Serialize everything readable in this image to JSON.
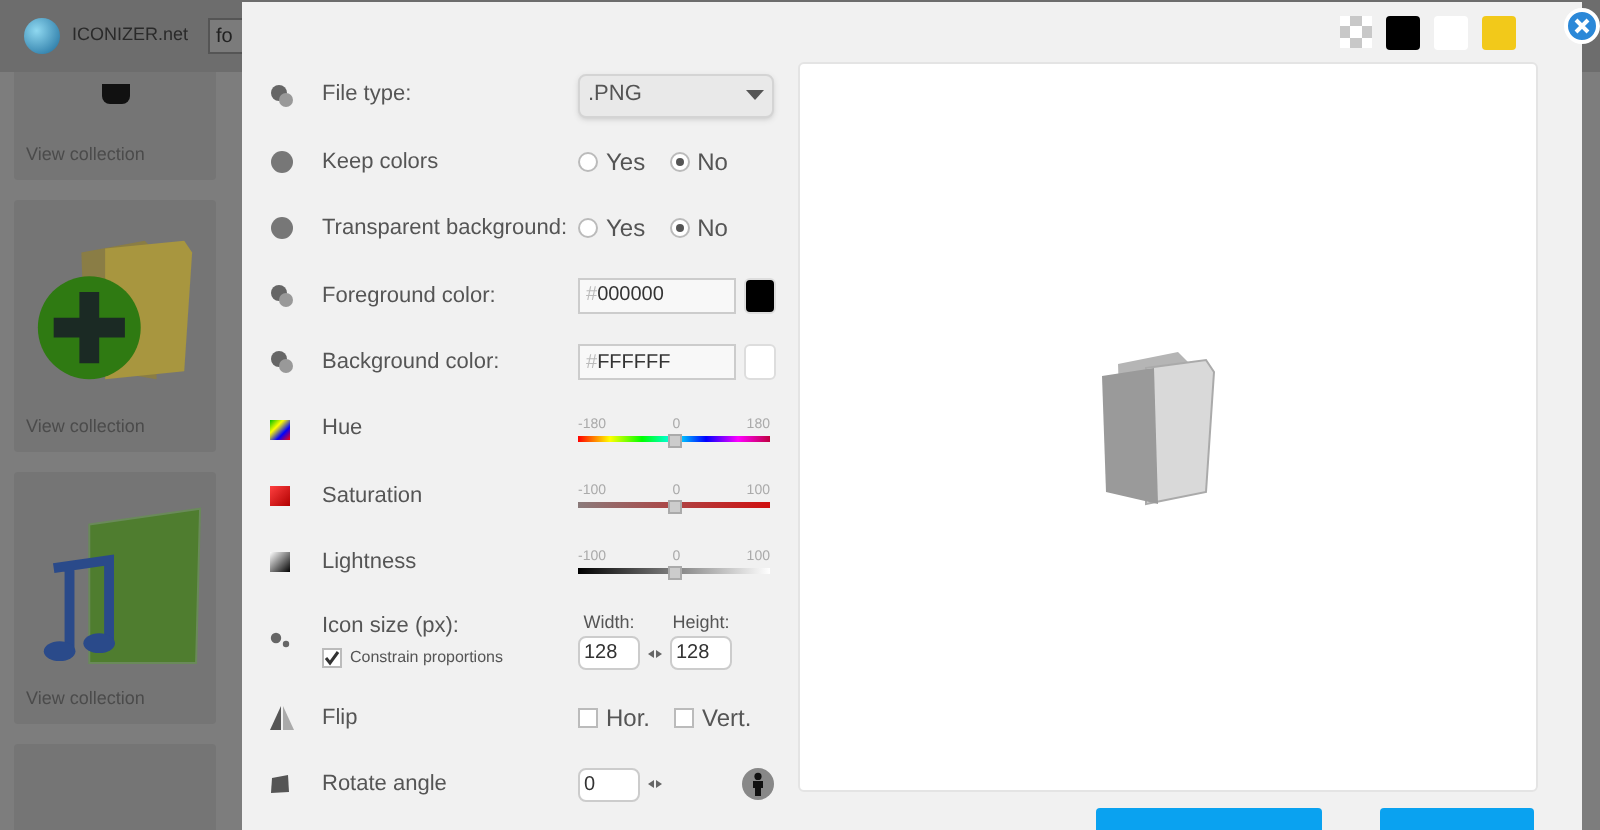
{
  "site": {
    "logo": "ICONIZER.net",
    "search": {
      "value": "fo"
    }
  },
  "collections": [
    {
      "label": "View collection",
      "kind": "partial"
    },
    {
      "label": "View collection",
      "kind": "add"
    },
    {
      "label": "View collection",
      "kind": "music"
    },
    {
      "kind": "empty"
    }
  ],
  "swatches": [
    {
      "kind": "checker"
    },
    {
      "kind": "solid",
      "color": "#000000"
    },
    {
      "kind": "solid",
      "color": "#ffffff"
    },
    {
      "kind": "solid",
      "color": "#f2c91a"
    }
  ],
  "settings": [
    {
      "kind": "select",
      "label": "File type:",
      "value": ".PNG"
    },
    {
      "kind": "radio",
      "label": "Keep colors",
      "options": [
        {
          "label": "Yes",
          "selected": false
        },
        {
          "label": "No",
          "selected": true
        }
      ]
    },
    {
      "kind": "radio",
      "label": "Transparent background:",
      "options": [
        {
          "label": "Yes",
          "selected": false
        },
        {
          "label": "No",
          "selected": true
        }
      ]
    },
    {
      "kind": "color",
      "label": "Foreground color:",
      "prefix": "#",
      "value": "000000",
      "color": "#000000"
    },
    {
      "kind": "color",
      "label": "Background color:",
      "prefix": "#",
      "value": "FFFFFF",
      "color": "#ffffff"
    },
    {
      "kind": "hue",
      "label": "Hue",
      "ticks": [
        "-180",
        "0",
        "180"
      ],
      "level": 0.5
    },
    {
      "kind": "saturation",
      "label": "Saturation",
      "ticks": [
        "-100",
        "0",
        "100"
      ],
      "level": 0.5
    },
    {
      "kind": "lightness",
      "label": "Lightness",
      "ticks": [
        "-100",
        "0",
        "100"
      ],
      "level": 0.5
    },
    {
      "kind": "size",
      "label": "Icon size (px):",
      "constrain": {
        "label": "Constrain proportions",
        "checked": true
      },
      "width": {
        "label": "Width:",
        "value": "128"
      },
      "height": {
        "label": "Height:",
        "value": "128"
      }
    },
    {
      "kind": "flip",
      "label": "Flip",
      "options": [
        {
          "label": "Hor.",
          "checked": false
        },
        {
          "label": "Vert.",
          "checked": false
        }
      ]
    },
    {
      "kind": "rotate",
      "label": "Rotate angle",
      "value": "0"
    }
  ]
}
